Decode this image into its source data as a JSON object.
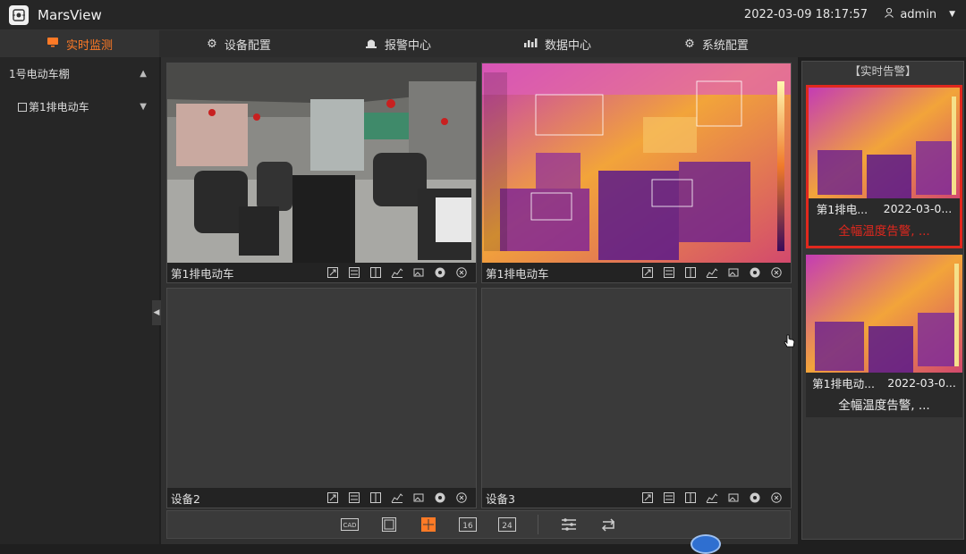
{
  "app": {
    "title": "MarsView",
    "datetime": "2022-03-09 18:17:57",
    "user": "admin"
  },
  "nav": {
    "tabs": [
      {
        "label": "实时监测",
        "icon": "monitor-icon",
        "active": true
      },
      {
        "label": "设备配置",
        "icon": "gear-icon",
        "active": false
      },
      {
        "label": "报警中心",
        "icon": "alarm-icon",
        "active": false
      },
      {
        "label": "数据中心",
        "icon": "chart-icon",
        "active": false
      },
      {
        "label": "系统配置",
        "icon": "gear-icon",
        "active": false
      }
    ]
  },
  "sidebar": {
    "items": [
      {
        "label": "1号电动车棚",
        "expanded": true
      },
      {
        "label": "第1排电动车",
        "expanded": false
      }
    ]
  },
  "grid": {
    "cells": [
      {
        "name": "第1排电动车",
        "feed": "visible"
      },
      {
        "name": "第1排电动车",
        "feed": "thermal"
      },
      {
        "name": "设备2",
        "feed": "empty"
      },
      {
        "name": "设备3",
        "feed": "empty"
      }
    ],
    "tool_icons": [
      "fullscreen-icon",
      "switch-icon",
      "split-icon",
      "chart-icon",
      "image-icon",
      "snapshot-icon",
      "close-icon"
    ]
  },
  "toolbar": {
    "layouts": [
      {
        "label": "CAD",
        "icon": "cad-icon"
      },
      {
        "label": "",
        "icon": "layout-1-icon"
      },
      {
        "label": "",
        "icon": "layout-4-icon",
        "active": true
      },
      {
        "label": "16",
        "icon": "layout-16-icon"
      },
      {
        "label": "24",
        "icon": "layout-24-icon"
      }
    ]
  },
  "alarms": {
    "title": "【实时告警】",
    "items": [
      {
        "device": "第1排电...",
        "time": "2022-03-0...",
        "type": "全幅温度告警, ...",
        "active": true
      },
      {
        "device": "第1排电动...",
        "time": "2022-03-0...",
        "type": "全幅温度告警, ...",
        "active": false
      }
    ]
  },
  "colors": {
    "accent": "#ff7a26",
    "alarm_red": "#e0281e",
    "thermal_hot": "#f5a623",
    "thermal_cold": "#5a1a8a"
  }
}
